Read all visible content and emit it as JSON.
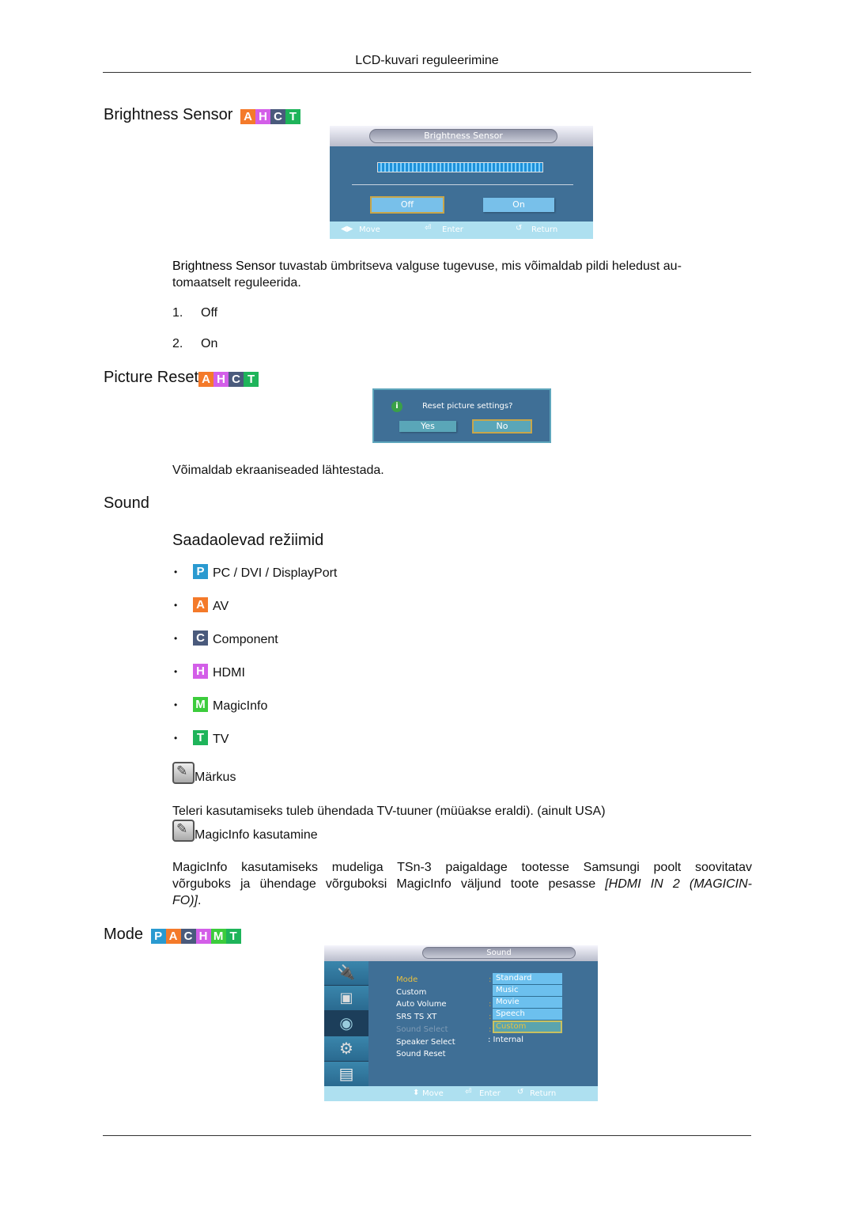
{
  "header": {
    "title": "LCD-kuvari reguleerimine"
  },
  "sections": {
    "brightness_sensor": {
      "title": "Brightness Sensor",
      "badges": [
        "A",
        "H",
        "C",
        "T"
      ],
      "osd": {
        "title": "Brightness Sensor",
        "buttons": [
          {
            "label": "Off",
            "selected": true
          },
          {
            "label": "On",
            "selected": false
          }
        ],
        "footer": {
          "move": "Move",
          "enter": "Enter",
          "return": "Return"
        }
      },
      "description_bold": "Brightness Sensor",
      "description_rest": " tuvastab ümbritseva valguse tugevuse, mis võimaldab pildi heledust au-tomaatselt reguleerida.",
      "description_line1": " tuvastab ümbritseva valguse tugevuse, mis võimaldab pildi heledust au-",
      "description_line2": "tomaatselt reguleerida.",
      "options": [
        {
          "num": "1.",
          "label": "Off"
        },
        {
          "num": "2.",
          "label": "On"
        }
      ]
    },
    "picture_reset": {
      "title": "Picture Reset",
      "badges": [
        "A",
        "H",
        "C",
        "T"
      ],
      "dialog": {
        "message": "Reset picture settings?",
        "yes": "Yes",
        "no": "No"
      },
      "description": "Võimaldab ekraaniseaded lähtestada."
    },
    "sound": {
      "title": "Sound",
      "subtitle": "Saadaolevad režiimid",
      "modes": [
        {
          "badge": "P",
          "label": "PC / DVI / DisplayPort"
        },
        {
          "badge": "A",
          "label": "AV"
        },
        {
          "badge": "C",
          "label": "Component"
        },
        {
          "badge": "H",
          "label": "HDMI"
        },
        {
          "badge": "M",
          "label": "MagicInfo"
        },
        {
          "badge": "T",
          "label": "TV"
        }
      ],
      "note_label": "Märkus",
      "note_text": "Teleri kasutamiseks tuleb ühendada TV-tuuner (müüakse eraldi). (ainult USA)",
      "magicinfo_label": "MagicInfo kasutamine",
      "magicinfo_p1_bold": "MagicInfo",
      "magicinfo_p1_a": " kasutamiseks mudeliga TSn-3 paigaldage tootesse Samsungi poolt soovitatav",
      "magicinfo_p2_a": "võrguboks ja ühendage võrguboksi ",
      "magicinfo_p2_bold": "MagicInfo",
      "magicinfo_p2_b": " väljund toote pesasse ",
      "magicinfo_p2_italic": "[HDMI IN 2 (MAGICIN-",
      "magicinfo_p3_italic": "FO)]",
      "magicinfo_p3_end": "."
    },
    "mode": {
      "title": "Mode",
      "badges": [
        "P",
        "A",
        "C",
        "H",
        "M",
        "T"
      ],
      "osd": {
        "title": "Sound",
        "menu": [
          {
            "label": "Mode",
            "value": "",
            "state": "active"
          },
          {
            "label": "Custom",
            "value": "",
            "state": "normal"
          },
          {
            "label": "Auto Volume",
            "value": "",
            "state": "normal"
          },
          {
            "label": "SRS TS XT",
            "value": "",
            "state": "normal"
          },
          {
            "label": "Sound Select",
            "value": "",
            "state": "disabled"
          },
          {
            "label": "Speaker Select",
            "value": ": Internal",
            "state": "normal"
          },
          {
            "label": "Sound Reset",
            "value": "",
            "state": "normal"
          }
        ],
        "dropdown": [
          "Standard",
          "Music",
          "Movie",
          "Speech",
          "Custom"
        ],
        "dropdown_selected": "Custom",
        "sidebar_icons": [
          "input-icon",
          "picture-icon",
          "sound-icon",
          "setup-icon",
          "multi-control-icon"
        ],
        "sidebar_selected": "sound-icon",
        "footer": {
          "move": "Move",
          "enter": "Enter",
          "return": "Return"
        }
      }
    }
  },
  "colors": {
    "badge_A": "#f47a2a",
    "badge_H": "#d35ee8",
    "badge_C": "#4a5a7c",
    "badge_T": "#1eb45a",
    "badge_P": "#2a9ad0",
    "badge_M": "#3ccc3c",
    "osd_bg": "#3f6f96",
    "osd_button": "#78c0ea",
    "osd_highlight": "#e8c040"
  }
}
